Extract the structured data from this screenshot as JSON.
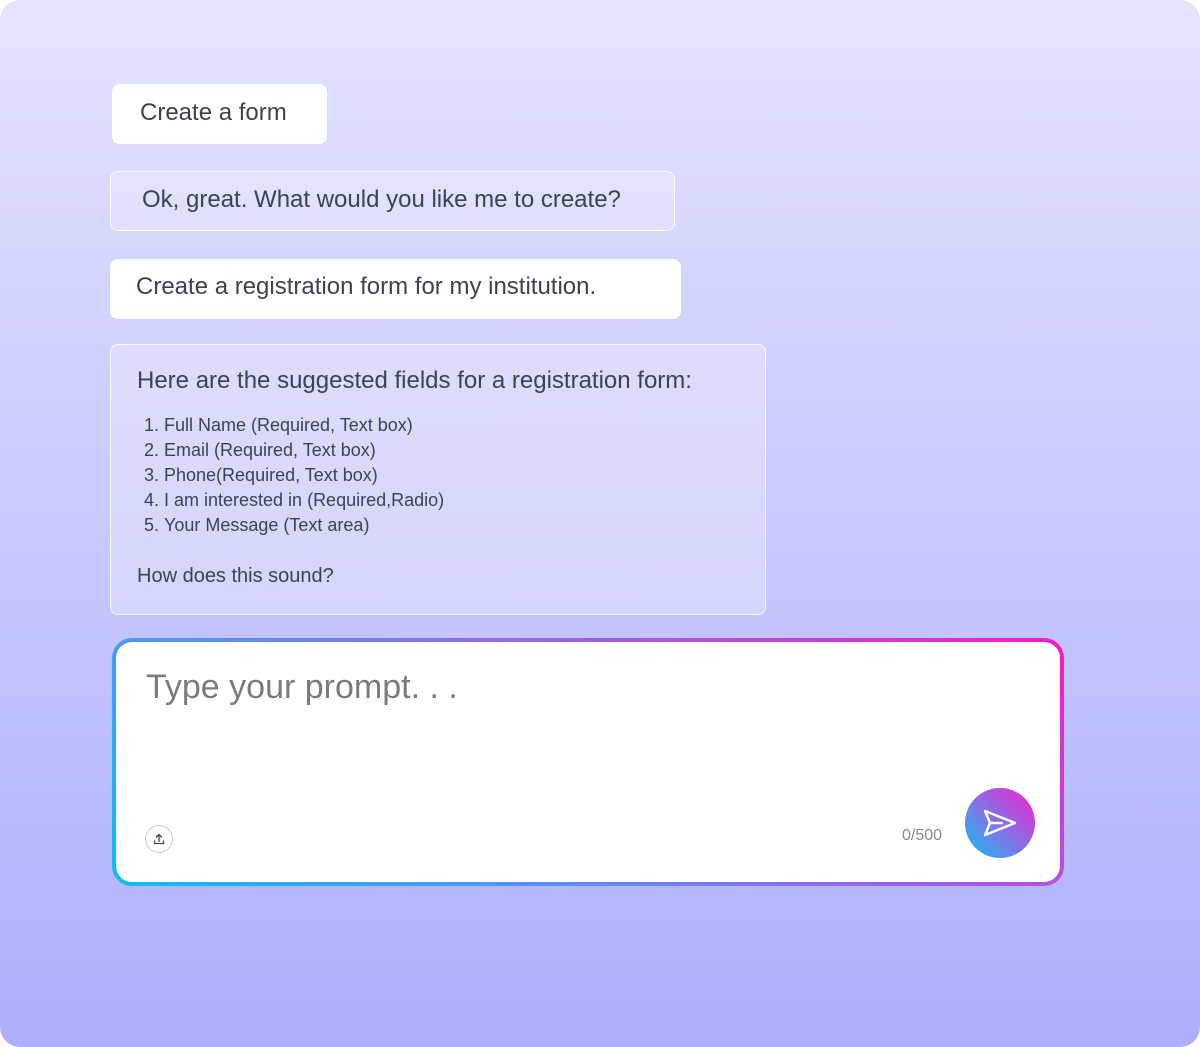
{
  "conversation": {
    "messages": [
      {
        "role": "user",
        "text": "Create a form"
      },
      {
        "role": "assistant",
        "text": "Ok, great. What would you like me to create?"
      },
      {
        "role": "user",
        "text": "Create a registration form for my institution."
      },
      {
        "role": "assistant",
        "heading": "Here are the suggested fields for a registration form:",
        "fields": [
          "Full Name (Required, Text box)",
          "Email (Required, Text box)",
          "Phone(Required, Text box)",
          "I am interested in (Required,Radio)",
          "Your Message (Text area)"
        ],
        "closing": "How does this sound?"
      }
    ]
  },
  "prompt": {
    "placeholder": "Type your prompt. . .",
    "value": "",
    "counter": "0/500",
    "upload_icon": "upload-icon",
    "send_icon": "send-icon"
  },
  "colors": {
    "background_top": "#e3e4fe",
    "background_bottom": "#adaefc",
    "gradient_cyan": "#0bbef0",
    "gradient_magenta": "#f21ac9",
    "text": "#3b4354"
  }
}
